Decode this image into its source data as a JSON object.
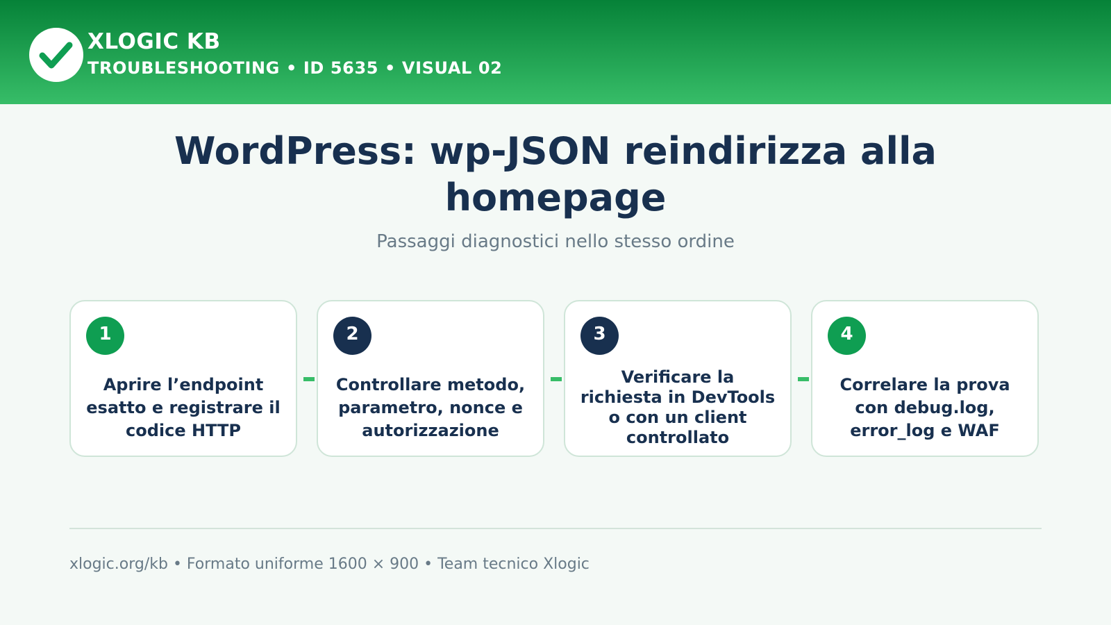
{
  "header": {
    "logo_icon": "checkmark-icon",
    "brand": "XLOGIC KB",
    "meta": "TROUBLESHOOTING • ID 5635 • VISUAL 02"
  },
  "main": {
    "title": "WordPress: wp-JSON reindirizza alla homepage",
    "subtitle": "Passaggi diagnostici nello stesso ordine"
  },
  "steps": [
    {
      "number": "1",
      "text": "Aprire l’endpoint esatto e registrare il codice HTTP",
      "badge_color": "#0f9e52"
    },
    {
      "number": "2",
      "text": "Controllare metodo, parametro, nonce e autorizzazione",
      "badge_color": "#18304f"
    },
    {
      "number": "3",
      "text": "Verificare la richiesta in DevTools o con un client controllato",
      "badge_color": "#18304f"
    },
    {
      "number": "4",
      "text": "Correlare la prova con debug.log, error_log e WAF",
      "badge_color": "#0f9e52"
    }
  ],
  "footer": {
    "text": "xlogic.org/kb • Formato uniforme 1600 × 900 • Team tecnico Xlogic"
  },
  "colors": {
    "header_dark": "#068238",
    "header_light": "#37bd68",
    "navy": "#18304f",
    "accent_green": "#0f9e52",
    "background": "#f4f9f6"
  }
}
